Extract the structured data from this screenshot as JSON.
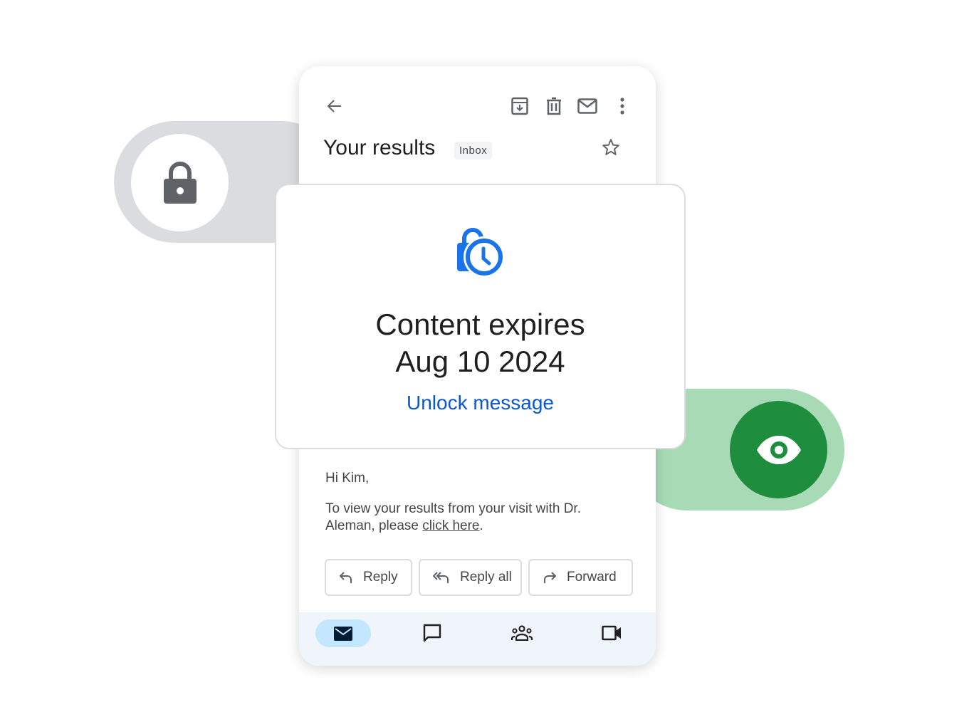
{
  "email": {
    "title": "Your results",
    "label_badge": "Inbox",
    "greeting": "Hi Kim,",
    "body_text": "To view your results from your visit with Dr. Aleman, please ",
    "body_link": "click here",
    "body_end": ".",
    "actions": [
      {
        "label": "Reply",
        "icon": "reply-icon"
      },
      {
        "label": "Reply all",
        "icon": "reply-all-icon"
      },
      {
        "label": "Forward",
        "icon": "forward-icon"
      }
    ]
  },
  "toolbar_icons": [
    "back-arrow-icon",
    "archive-icon",
    "delete-icon",
    "mark-unread-icon",
    "more-vert-icon",
    "star-icon"
  ],
  "bottom_nav": [
    "mail-icon",
    "chat-icon",
    "spaces-icon",
    "meet-icon"
  ],
  "overlay": {
    "line1": "Content expires",
    "line2": "Aug 10 2024",
    "unlock_label": "Unlock message"
  },
  "colors": {
    "accent_blue": "#1a73e8",
    "link_blue": "#0b57d0",
    "green": "#1e8e3e",
    "green_light": "#a8dab5",
    "gray_pill": "#dadce0",
    "nav_active": "#c2e7ff"
  }
}
